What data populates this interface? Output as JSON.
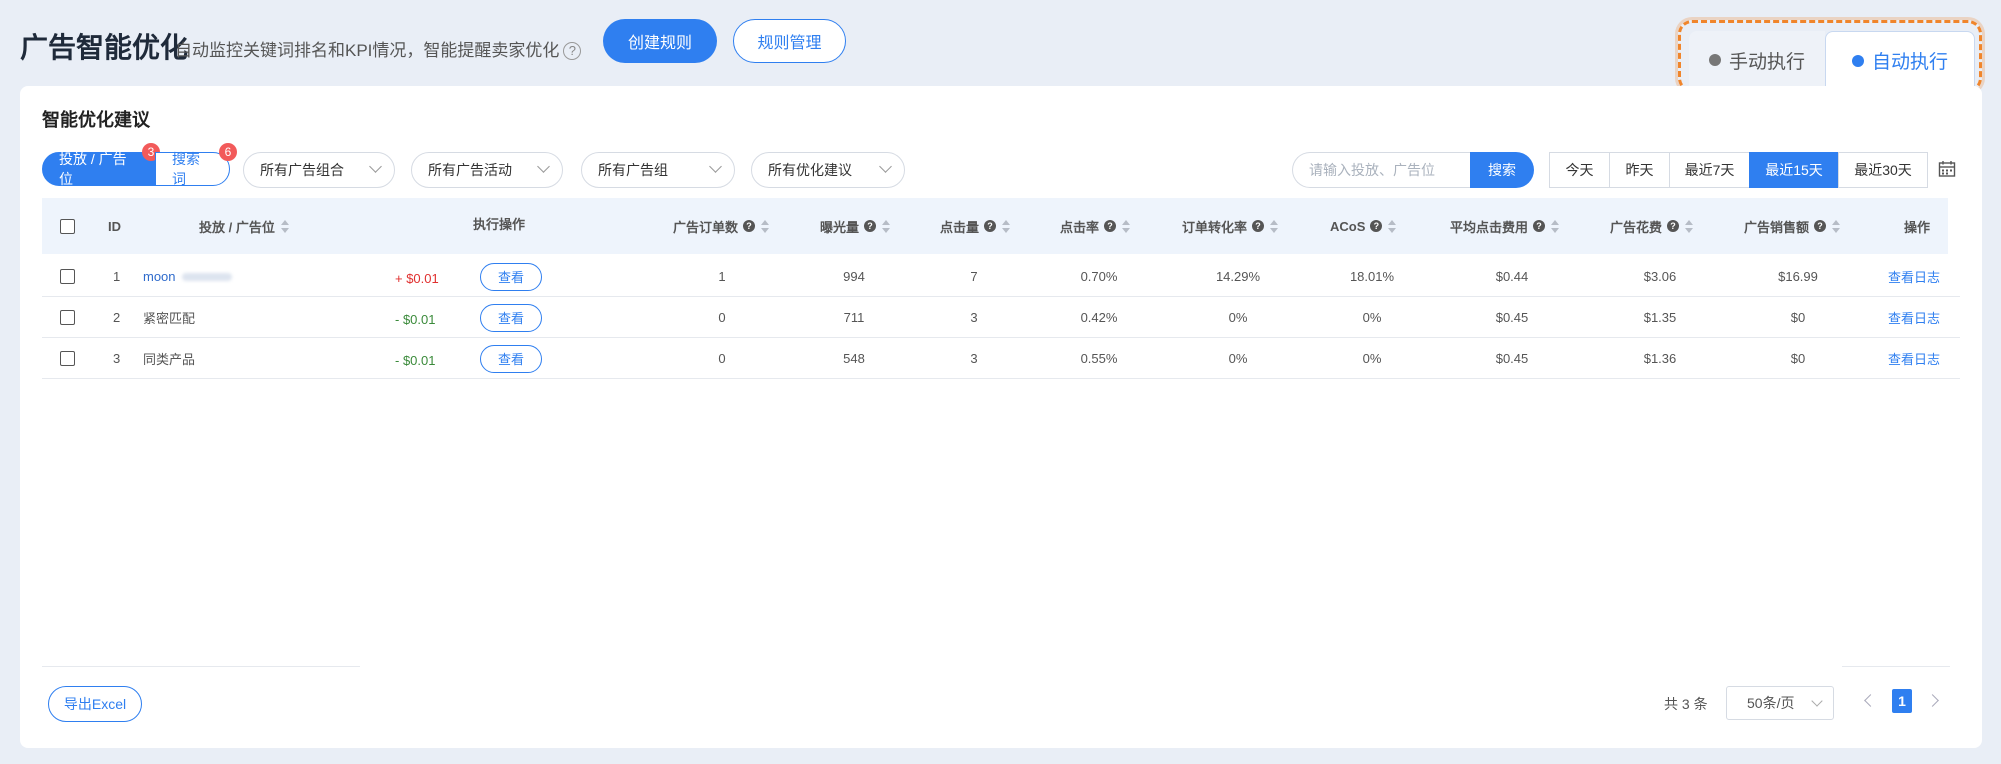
{
  "header": {
    "title": "广告智能优化",
    "subtitle": "自动监控关键词排名和KPI情况，智能提醒卖家优化",
    "help_icon": "?",
    "create_rule_label": "创建规则",
    "manage_rules_label": "规则管理"
  },
  "mode_tabs": {
    "manual_label": "手动执行",
    "auto_label": "自动执行",
    "active": "auto"
  },
  "card": {
    "title": "智能优化建议",
    "segments": [
      {
        "label": "投放 / 广告位",
        "badge": "3",
        "active": true
      },
      {
        "label": "搜索词",
        "badge": "6",
        "active": false
      }
    ],
    "filters": [
      "所有广告组合",
      "所有广告活动",
      "所有广告组",
      "所有优化建议"
    ],
    "search": {
      "placeholder": "请输入投放、广告位",
      "button_label": "搜索"
    },
    "date_ranges": [
      "今天",
      "昨天",
      "最近7天",
      "最近15天",
      "最近30天"
    ],
    "active_date_range": "最近15天"
  },
  "table": {
    "headers": {
      "id": "ID",
      "target": "投放 / 广告位",
      "action": "执行操作",
      "orders": "广告订单数",
      "impressions": "曝光量",
      "clicks": "点击量",
      "ctr": "点击率",
      "cvr": "订单转化率",
      "acos": "ACoS",
      "cpc": "平均点击费用",
      "spend": "广告花费",
      "sales": "广告销售额",
      "ops": "操作"
    },
    "rows": [
      {
        "id": "1",
        "name": "moon",
        "change": "+ $0.01",
        "view": "查看",
        "orders": "1",
        "impressions": "994",
        "clicks": "7",
        "ctr": "0.70%",
        "cvr": "14.29%",
        "acos": "18.01%",
        "cpc": "$0.44",
        "spend": "$3.06",
        "sales": "$16.99",
        "log": "查看日志"
      },
      {
        "id": "2",
        "name": "紧密匹配",
        "change": "- $0.01",
        "view": "查看",
        "orders": "0",
        "impressions": "711",
        "clicks": "3",
        "ctr": "0.42%",
        "cvr": "0%",
        "acos": "0%",
        "cpc": "$0.45",
        "spend": "$1.35",
        "sales": "$0",
        "log": "查看日志"
      },
      {
        "id": "3",
        "name": "同类产品",
        "change": "- $0.01",
        "view": "查看",
        "orders": "0",
        "impressions": "548",
        "clicks": "3",
        "ctr": "0.55%",
        "cvr": "0%",
        "acos": "0%",
        "cpc": "$0.45",
        "spend": "$1.36",
        "sales": "$0",
        "log": "查看日志"
      }
    ]
  },
  "footer": {
    "export_label": "导出Excel",
    "total_text": "共 3 条",
    "page_size": "50条/页",
    "current_page": "1"
  },
  "icons": {
    "help": "question-circle-icon",
    "calendar": "calendar-icon",
    "sort": "sort-icon",
    "prev": "chevron-left-icon",
    "next": "chevron-right-icon"
  },
  "colors": {
    "accent": "#2f7ff0",
    "highlight_border": "#f0852b",
    "badge": "#f25a5a",
    "increase": "#e0302f",
    "decrease": "#3a8a3a"
  }
}
